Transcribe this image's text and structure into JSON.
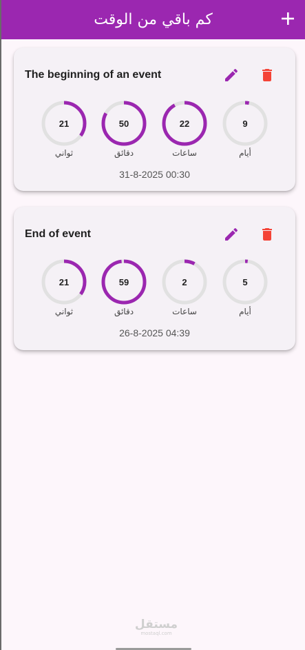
{
  "app": {
    "title": "كم باقي من الوقت",
    "add_icon": "plus-icon",
    "primary_color": "#9b27b0",
    "delete_color": "#f44336"
  },
  "cards": [
    {
      "title": "The beginning of an event",
      "date": "31-8-2025 00:30",
      "counters": [
        {
          "label": "أيام",
          "value": "9",
          "progress": 0.03
        },
        {
          "label": "ساعات",
          "value": "22",
          "progress": 0.92
        },
        {
          "label": "دقائق",
          "value": "50",
          "progress": 0.83
        },
        {
          "label": "ثواني",
          "value": "21",
          "progress": 0.35
        }
      ]
    },
    {
      "title": "End of event",
      "date": "26-8-2025 04:39",
      "counters": [
        {
          "label": "أيام",
          "value": "5",
          "progress": 0.02
        },
        {
          "label": "ساعات",
          "value": "2",
          "progress": 0.08
        },
        {
          "label": "دقائق",
          "value": "59",
          "progress": 0.98
        },
        {
          "label": "ثواني",
          "value": "21",
          "progress": 0.35
        }
      ]
    }
  ],
  "watermark": {
    "big": "مستقل",
    "small": "mostaql.com"
  }
}
